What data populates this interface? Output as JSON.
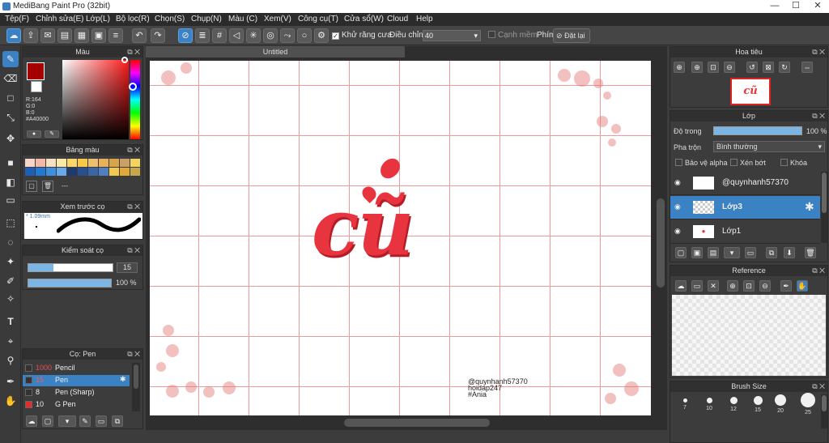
{
  "window": {
    "title": "MediBang Paint Pro (32bit)",
    "minimize": "—",
    "maximize": "☐",
    "close": "✕"
  },
  "menu": [
    "Tệp(F)",
    "Chỉnh sửa(E)",
    "Lớp(L)",
    "Bộ lọc(R)",
    "Chọn(S)",
    "Chụp(N)",
    "Màu (C)",
    "Xem(V)",
    "Công cụ(T)",
    "Cửa sổ(W)",
    "Cloud",
    "Help"
  ],
  "toolbar": {
    "antialias_label": "Khử răng cưa",
    "adjust_label": "Điều chỉnh",
    "adjust_value": "40",
    "edge_label": "Cạnh mềm",
    "key_label": "Phím",
    "reset_label": "Đặt lại"
  },
  "color_panel": {
    "title": "Màu",
    "r": "R:164",
    "g": "G:0",
    "b": "B:0",
    "hex": "#A40000",
    "primary": "#a40000"
  },
  "palette_panel": {
    "title": "Bảng màu",
    "swatches": [
      "#f7d3c8",
      "#f2b8a8",
      "#f6e1c2",
      "#fbe9a8",
      "#fbd76a",
      "#f9c74a",
      "#ecc06c",
      "#e6b15a",
      "#d9a44a",
      "#caa06a",
      "#f4d35e",
      "#1d5fb5",
      "#2378d1",
      "#3f8fe0",
      "#6aa9e8",
      "#1e3a6e",
      "#2a4f8f",
      "#3a66a8",
      "#4f7fbf",
      "#f2c94c",
      "#e0a93a",
      "#caa64a"
    ],
    "dash": "---"
  },
  "brush_preview": {
    "title": "Xem trước cọ",
    "size": "1.09mm"
  },
  "brush_control": {
    "title": "Kiểm soát cọ",
    "size_value": "15",
    "opacity_value": "100 %"
  },
  "brush_list": {
    "title": "Cọ: Pen",
    "items": [
      {
        "size": "1000",
        "name": "Pencil",
        "color": "#333333"
      },
      {
        "size": "15",
        "name": "Pen",
        "color": "#333333"
      },
      {
        "size": "8",
        "name": "Pen (Sharp)",
        "color": "#333333"
      },
      {
        "size": "10",
        "name": "G Pen",
        "color": "#e52b2b"
      }
    ]
  },
  "canvas": {
    "tab_label": "Untitled",
    "art_text": "cũ",
    "sig1": "@quynhanh57370",
    "sig2": "hoidap247",
    "sig3": "#Ania"
  },
  "navigator": {
    "title": "Hoa tiêu",
    "thumb_text": "cũ"
  },
  "layer_panel": {
    "title": "Lớp",
    "opacity_label": "Độ trong",
    "opacity_value": "100 %",
    "blend_label": "Pha trộn",
    "blend_value": "Bình thường",
    "protect_alpha": "Bảo vệ alpha",
    "clipping": "Xén bớt",
    "lock": "Khóa",
    "layers": [
      {
        "name": "@quynhanh57370",
        "selected": false
      },
      {
        "name": "Lớp3",
        "selected": true
      },
      {
        "name": "Lớp1",
        "selected": false
      }
    ]
  },
  "reference_panel": {
    "title": "Reference"
  },
  "brush_size_panel": {
    "title": "Brush Size",
    "sizes": [
      "7",
      "10",
      "12",
      "15",
      "20",
      "25"
    ]
  },
  "colors": {
    "accent": "#3b82c4",
    "grid": "#ef9a9a",
    "art": "#e8343f"
  }
}
